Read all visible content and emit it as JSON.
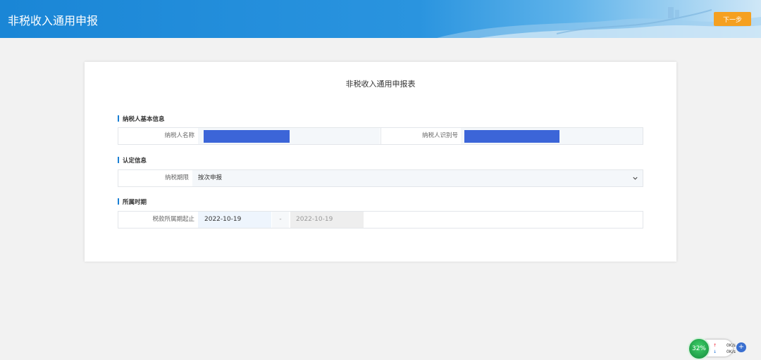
{
  "header": {
    "title": "非税收入通用申报",
    "next_button": "下一步"
  },
  "form": {
    "title": "非税收入通用申报表",
    "sections": {
      "taxpayer_info": "纳税人基本信息",
      "recognition_info": "认定信息",
      "period": "所属时期"
    },
    "taxpayer_name_label": "纳税人名称",
    "taxpayer_id_label": "纳税人识别号",
    "tax_period_label": "纳税期限",
    "tax_period_value": "按次申报",
    "period_label": "税款所属期起止",
    "period_start": "2022-10-19",
    "period_separator": "-",
    "period_end": "2022-10-19"
  },
  "widget": {
    "percent": "32%",
    "upload": "0K/s",
    "download": "0K/s",
    "plus": "+"
  },
  "colors": {
    "header_blue": "#1a86d6",
    "next_button": "#f5a020",
    "redaction": "#3c65d8",
    "section_marker": "#1a7fd4"
  }
}
